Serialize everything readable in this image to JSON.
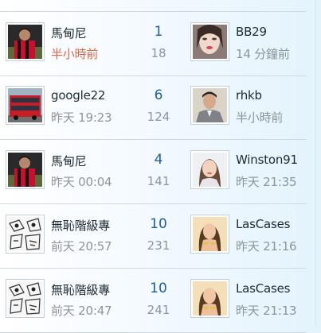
{
  "rows": [
    {
      "left": {
        "avatar": "soccer-player-avatar",
        "name": "馬甸尼",
        "time": "半小時前",
        "time_highlight": true
      },
      "count": "1",
      "views": "18",
      "right": {
        "avatar": "woman-portrait-avatar",
        "name": "BB29",
        "time": "14 分鐘前"
      }
    },
    {
      "left": {
        "avatar": "red-double-decker-bus-avatar",
        "name": "google22",
        "time": "昨天 19:23"
      },
      "count": "6",
      "views": "124",
      "right": {
        "avatar": "man-in-suit-avatar",
        "name": "rhkb",
        "time": "半小時前"
      }
    },
    {
      "left": {
        "avatar": "soccer-player-avatar",
        "name": "馬甸尼",
        "time": "昨天 00:04"
      },
      "count": "4",
      "views": "141",
      "right": {
        "avatar": "woman-photo-avatar",
        "name": "Winston91",
        "time": "昨天 21:35"
      }
    },
    {
      "left": {
        "avatar": "manga-comic-avatar",
        "name": "無恥階級專",
        "time": "前天 20:57"
      },
      "count": "10",
      "views": "231",
      "right": {
        "avatar": "bikini-model-avatar",
        "name": "LasCases",
        "time": "昨天 21:16"
      }
    },
    {
      "left": {
        "avatar": "manga-comic-avatar",
        "name": "無恥階級專",
        "time": "前天 20:47"
      },
      "count": "10",
      "views": "241",
      "right": {
        "avatar": "bikini-model-avatar",
        "name": "LasCases",
        "time": "昨天 21:13"
      }
    }
  ],
  "colors": {
    "highlight_time": "#e2674a",
    "count": "#1f5fa0",
    "muted": "#8d959c"
  }
}
